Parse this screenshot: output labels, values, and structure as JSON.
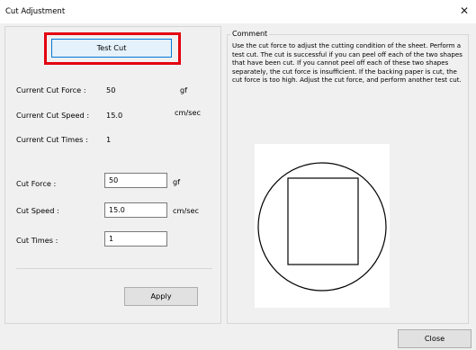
{
  "window": {
    "title": "Cut Adjustment",
    "close_glyph": "✕"
  },
  "test_cut": {
    "label": "Test Cut"
  },
  "current": {
    "force_label": "Current Cut Force :",
    "force_value": "50",
    "force_unit": "gf",
    "speed_label": "Current Cut Speed :",
    "speed_value": "15.0",
    "speed_unit": "cm/sec",
    "times_label": "Current Cut Times :",
    "times_value": "1"
  },
  "settings": {
    "force_label": "Cut Force :",
    "force_value": "50",
    "force_unit": "gf",
    "speed_label": "Cut Speed :",
    "speed_value": "15.0",
    "speed_unit": "cm/sec",
    "times_label": "Cut Times :",
    "times_value": "1"
  },
  "apply": {
    "label": "Apply"
  },
  "comment": {
    "title": "Comment",
    "text": "Use the cut force to adjust the cutting condition of the sheet. Perform a test cut. The cut is successful if you can peel off each of the two shapes that have been cut. If you cannot peel off each of these two shapes separately, the cut force is insufficient. If the backing paper is cut, the cut force is too high. Adjust the cut force, and perform another test cut."
  },
  "close": {
    "label": "Close"
  },
  "icons": {
    "close": "close-icon"
  },
  "colors": {
    "highlight": "#e3000f",
    "focus": "#0078d7"
  }
}
